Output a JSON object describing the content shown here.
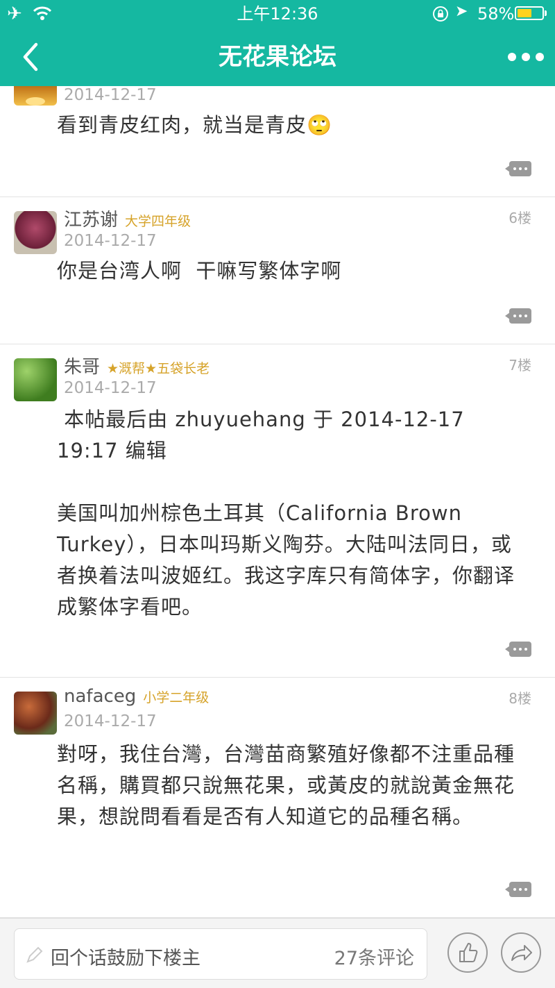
{
  "status_bar": {
    "time": "上午12:36",
    "battery_percent": "58%",
    "battery_level": 0.58
  },
  "nav": {
    "title": "无花果论坛"
  },
  "posts": [
    {
      "author": "",
      "rank": "",
      "floor": "",
      "date": "2014-12-17",
      "content": "看到青皮红肉，就当是青皮🙄"
    },
    {
      "author": "江苏谢",
      "rank": "大学四年级",
      "floor": "6楼",
      "date": "2014-12-17",
      "content": "你是台湾人啊  干嘛写繁体字啊"
    },
    {
      "author": "朱哥",
      "rank": "★溉帮★五袋长老",
      "floor": "7楼",
      "date": "2014-12-17",
      "content": " 本帖最后由 zhuyuehang 于 2014-12-17 19:17 编辑\n\n美国叫加州棕色土耳其（California Brown Turkey），日本叫玛斯义陶芬。大陆叫法同日，或者换着法叫波姬红。我这字库只有简体字，你翻译成繁体字看吧。"
    },
    {
      "author": "nafaceg",
      "rank": "小学二年级",
      "floor": "8楼",
      "date": "2014-12-17",
      "content": "對呀，我住台灣，台灣苗商繁殖好像都不注重品種名稱，購買都只說無花果，或黃皮的就說黃金無花果，想說問看看是否有人知道它的品種名稱。"
    }
  ],
  "bottom_bar": {
    "reply_placeholder": "回个话鼓励下楼主",
    "comment_count": "27条评论"
  },
  "colors": {
    "accent": "#15b8a1",
    "rank": "#d6a32a",
    "battery": "#ffd21f"
  }
}
